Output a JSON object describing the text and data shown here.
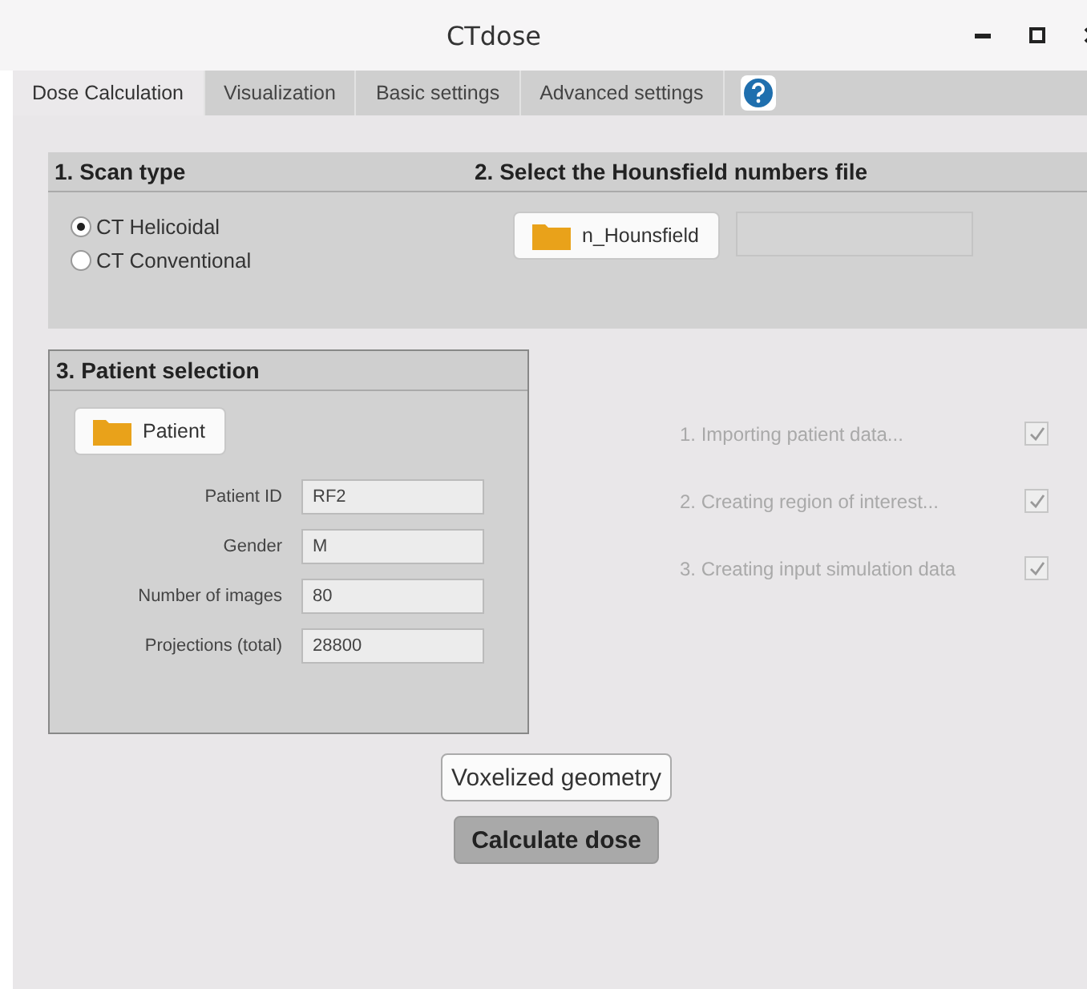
{
  "window": {
    "title": "CTdose"
  },
  "tabs": [
    {
      "label": "Dose Calculation",
      "selected": true
    },
    {
      "label": "Visualization",
      "selected": false
    },
    {
      "label": "Basic settings",
      "selected": false
    },
    {
      "label": "Advanced settings",
      "selected": false
    }
  ],
  "scan_type": {
    "title": "1. Scan type",
    "options": [
      {
        "label": "CT Helicoidal",
        "selected": true
      },
      {
        "label": "CT Conventional",
        "selected": false
      }
    ]
  },
  "hounsfield": {
    "title": "2. Select the Hounsfield numbers file",
    "button": "n_Hounsfield"
  },
  "patient": {
    "title": "3. Patient selection",
    "button": "Patient",
    "fields": [
      {
        "label": "Patient ID",
        "value": "RF2"
      },
      {
        "label": "Gender",
        "value": "M"
      },
      {
        "label": "Number of images",
        "value": "80"
      },
      {
        "label": "Projections (total)",
        "value": "28800"
      }
    ]
  },
  "steps": [
    {
      "label": "1. Importing patient data...",
      "checked": true,
      "disabled": true
    },
    {
      "label": "2. Creating region of interest...",
      "checked": true,
      "disabled": true
    },
    {
      "label": "3. Creating input simulation data",
      "checked": true,
      "disabled": true
    }
  ],
  "buttons": {
    "voxelized": "Voxelized geometry",
    "calculate": "Calculate dose"
  }
}
